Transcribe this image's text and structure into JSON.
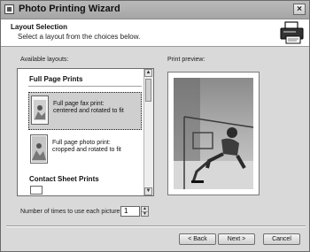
{
  "window": {
    "title": "Photo Printing Wizard",
    "close": "×"
  },
  "header": {
    "title": "Layout Selection",
    "subtitle": "Select a layout from the choices below."
  },
  "available_layouts": {
    "label": "Available layouts:",
    "sections": [
      {
        "name": "Full Page Prints"
      },
      {
        "name": "Contact Sheet Prints"
      }
    ],
    "options": [
      {
        "line1": "Full page fax print:",
        "line2": "centered and rotated to fit",
        "selected": true
      },
      {
        "line1": "Full page photo print:",
        "line2": "cropped and rotated to fit",
        "selected": false
      }
    ],
    "scroll": {
      "up": "▲",
      "down": "▼"
    }
  },
  "preview": {
    "label": "Print preview:"
  },
  "copies": {
    "label": "Number of times to use each picture:",
    "value": "1",
    "up": "▲",
    "down": "▼"
  },
  "buttons": {
    "back": "< Back",
    "next": "Next >",
    "cancel": "Cancel"
  }
}
